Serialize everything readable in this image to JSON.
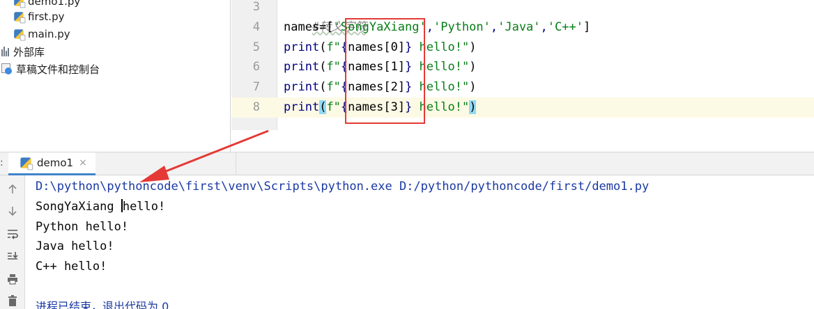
{
  "project_tree": {
    "items": [
      {
        "label": "demo1.py",
        "kind": "python-file"
      },
      {
        "label": "first.py",
        "kind": "python-file"
      },
      {
        "label": "main.py",
        "kind": "python-file"
      },
      {
        "label": "外部库",
        "kind": "external-libraries"
      },
      {
        "label": "草稿文件和控制台",
        "kind": "scratches-and-consoles"
      }
    ]
  },
  "editor": {
    "line_numbers": [
      "3",
      "4",
      "5",
      "6",
      "7",
      "8"
    ],
    "lines": [
      {
        "comment": "#转义字符"
      },
      {
        "prefix": "names=[",
        "s1": "'SongYaXiang'",
        "c1": ",",
        "s2": "'Python'",
        "c2": ",",
        "s3": "'Java'",
        "c3": ",",
        "s4": "'C++'",
        "suffix": "]"
      },
      {
        "fn": "print",
        "open": "(",
        "fp": "f\"",
        "lb": "{",
        "expr": "names[0]",
        "rb": "}",
        "tail": " hello!\"",
        "close": ")"
      },
      {
        "fn": "print",
        "open": "(",
        "fp": "f\"",
        "lb": "{",
        "expr": "names[1]",
        "rb": "}",
        "tail": " hello!\"",
        "close": ")"
      },
      {
        "fn": "print",
        "open": "(",
        "fp": "f\"",
        "lb": "{",
        "expr": "names[2]",
        "rb": "}",
        "tail": " hello!\"",
        "close": ")"
      },
      {
        "fn": "print",
        "open": "(",
        "fp": "f\"",
        "lb": "{",
        "expr": "names[3]",
        "rb": "}",
        "tail": " hello!\"",
        "close": ")"
      }
    ]
  },
  "run_panel": {
    "tab_label": "demo1",
    "tab_close": "×",
    "leading_glyph": ":",
    "toolbar_icons": [
      "arrow-up-icon",
      "arrow-down-icon",
      "soft-wrap-icon",
      "scroll-to-end-icon",
      "print-icon",
      "trash-icon"
    ],
    "console": {
      "command": "D:\\python\\pythoncode\\first\\venv\\Scripts\\python.exe D:/python/pythoncode/first/demo1.py",
      "output_first_pre": "SongYaXiang ",
      "output_first_post": "hello!",
      "output_rest": [
        "Python hello!",
        "Java hello!",
        "C++ hello!"
      ],
      "exit_message": "进程已结束，退出代码为 0"
    }
  },
  "colors": {
    "annotation_red": "#e53935",
    "string_green": "#067d17",
    "keyword_navy": "#000080",
    "console_blue": "#1a39a4",
    "caret_line": "#fcfae4",
    "tab_underline": "#4083c9"
  }
}
